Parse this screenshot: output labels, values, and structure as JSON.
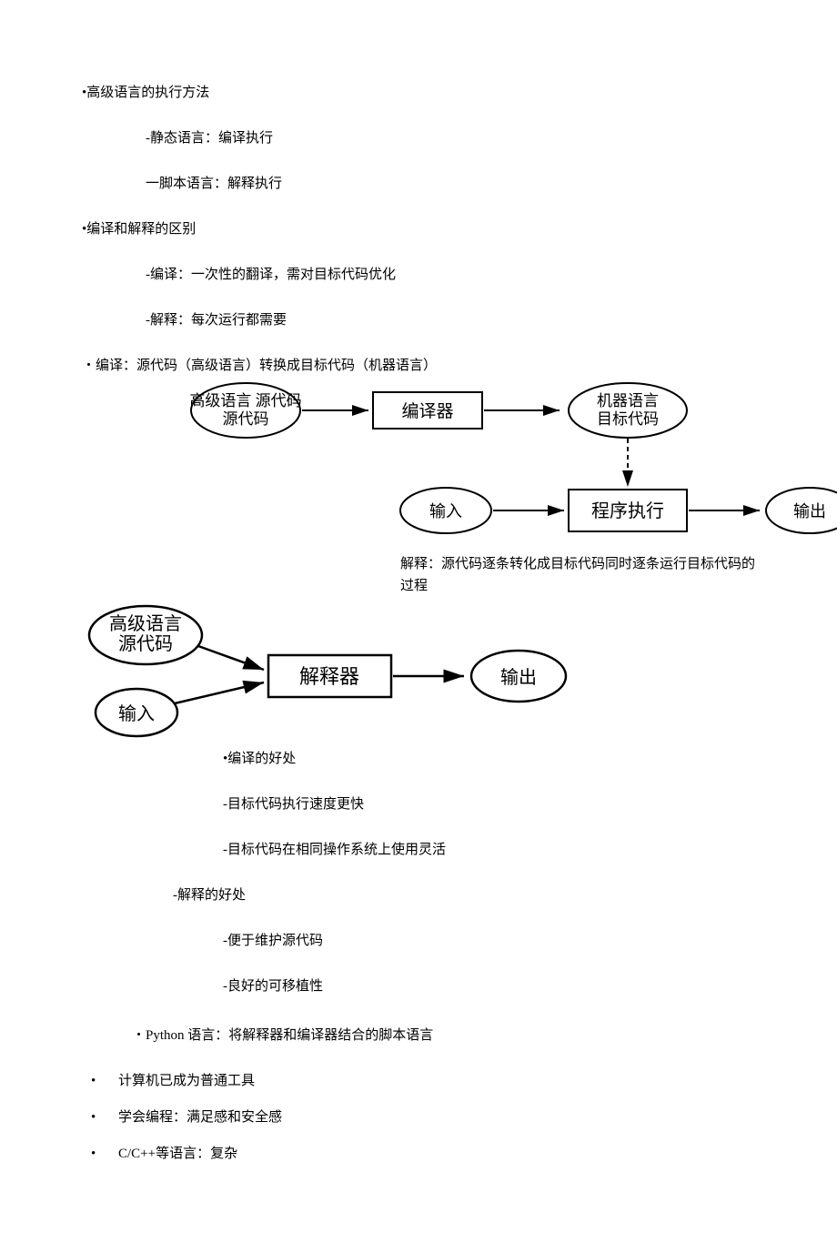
{
  "section1": {
    "title": "•高级语言的执行方法",
    "items": [
      "-静态语言：编译执行",
      "一脚本语言：解释执行"
    ]
  },
  "section2": {
    "title": "•编译和解释的区别",
    "items": [
      "-编译：一次性的翻译，需对目标代码优化",
      "-解释：每次运行都需要"
    ]
  },
  "compileLine": "・编译：源代码（高级语言）转换成目标代码（机器语言）",
  "compileDiagram": {
    "source": "高级语言\n源代码",
    "compiler": "编译器",
    "target": "机器语言\n目标代码",
    "input": "输入",
    "exec": "程序执行",
    "output": "输出"
  },
  "interpCaption": "解释：源代码逐条转化成目标代码同时逐条运行目标代码的过程",
  "interpDiagram": {
    "source": "高级语言\n源代码",
    "input": "输入",
    "interpreter": "解释器",
    "output": "输出"
  },
  "advCompile": {
    "title": "•编译的好处",
    "items": [
      "-目标代码执行速度更快",
      "-目标代码在相同操作系统上使用灵活"
    ]
  },
  "advInterp": {
    "title": "-解释的好处",
    "items": [
      "-便于维护源代码",
      "-良好的可移植性"
    ]
  },
  "pythonLine": "・Python 语言：将解释器和编译器结合的脚本语言",
  "bulletList": [
    "计算机已成为普通工具",
    "学会编程：满足感和安全感",
    "C/C++等语言：复杂"
  ]
}
